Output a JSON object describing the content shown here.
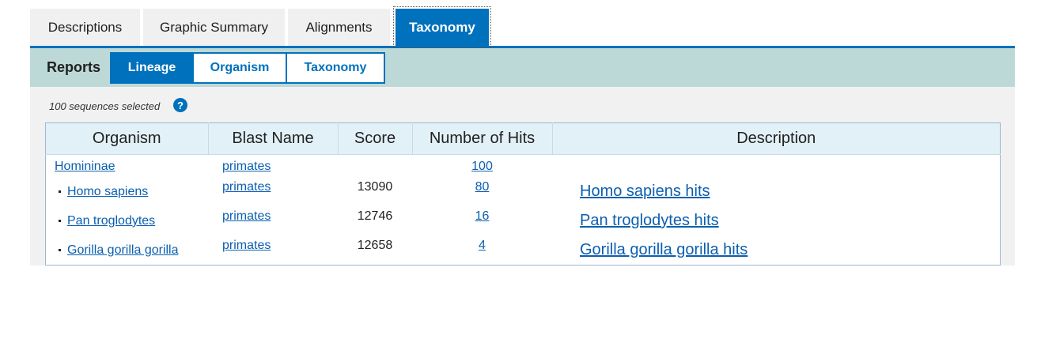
{
  "tabs": [
    {
      "label": "Descriptions"
    },
    {
      "label": "Graphic Summary"
    },
    {
      "label": "Alignments"
    },
    {
      "label": "Taxonomy",
      "active": true
    }
  ],
  "reports": {
    "label": "Reports",
    "tabs": [
      {
        "label": "Lineage",
        "active": true
      },
      {
        "label": "Organism"
      },
      {
        "label": "Taxonomy"
      }
    ]
  },
  "selection": {
    "note": "100 sequences selected",
    "help_icon": "?"
  },
  "table": {
    "headers": [
      "Organism",
      "Blast Name",
      "Score",
      "Number of Hits",
      "Description"
    ],
    "group": {
      "organism": "Homininae",
      "blast_name": "primates",
      "hits": "100"
    },
    "rows": [
      {
        "organism": "Homo sapiens",
        "blast_name": "primates",
        "score": "13090",
        "hits": "80",
        "description": "Homo sapiens hits"
      },
      {
        "organism": "Pan troglodytes",
        "blast_name": "primates",
        "score": "12746",
        "hits": "16",
        "description": "Pan troglodytes hits"
      },
      {
        "organism": "Gorilla gorilla gorilla",
        "blast_name": "primates",
        "score": "12658",
        "hits": "4",
        "description": "Gorilla gorilla gorilla hits"
      }
    ]
  },
  "colors": {
    "accent": "#0071bc",
    "reports_bar": "#bdd9d7",
    "panel": "#f1f1f1",
    "header_bg": "#e2f1f8",
    "link": "#0b5fb0"
  }
}
